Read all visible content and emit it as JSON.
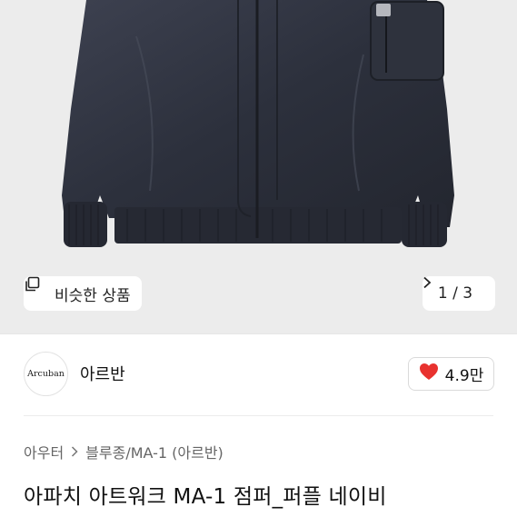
{
  "hero": {
    "image_alt": "",
    "similar_label": "비슷한 상품",
    "similar_icon": "copy-icon",
    "pager_text": "1 / 3",
    "pager_icon": "chevron-right-icon"
  },
  "brand": {
    "logo_text": "Arcuban",
    "name": "아르반"
  },
  "like": {
    "icon": "heart-icon",
    "color": "#e8322f",
    "count": "4.9만"
  },
  "breadcrumb": {
    "items": [
      "아우터",
      "블루종/MA-1 (아르반)"
    ],
    "separator_icon": "chevron-right-icon"
  },
  "product": {
    "title": "아파치 아트워크 MA-1 점퍼_퍼플 네이비"
  }
}
